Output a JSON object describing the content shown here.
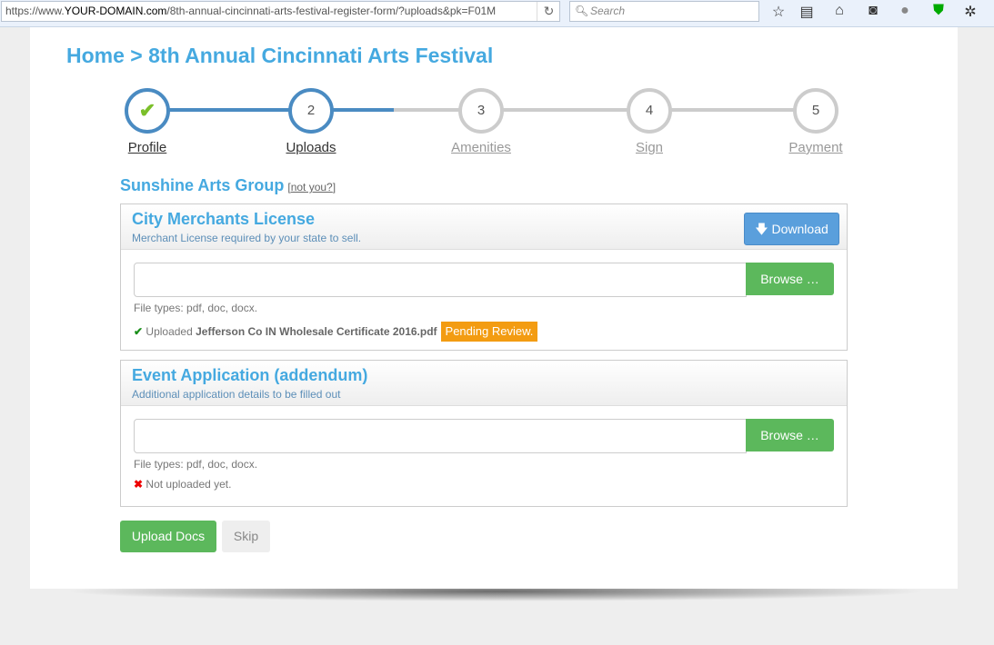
{
  "browser": {
    "url_prefix": "https://www.",
    "url_domain": "YOUR-DOMAIN.com",
    "url_rest": "/8th-annual-cincinnati-arts-festival-register-form/?uploads&pk=F01M",
    "search_placeholder": "Search"
  },
  "breadcrumb": "Home > 8th Annual Cincinnati Arts Festival",
  "steps": [
    {
      "label": "Profile",
      "num": "✔",
      "state": "done"
    },
    {
      "label": "Uploads",
      "num": "2",
      "state": "current"
    },
    {
      "label": "Amenities",
      "num": "3"
    },
    {
      "label": "Sign",
      "num": "4"
    },
    {
      "label": "Payment",
      "num": "5"
    }
  ],
  "group": {
    "name": "Sunshine Arts Group",
    "not_you": "not you?"
  },
  "cards": [
    {
      "title": "City Merchants License",
      "subtitle": "Merchant License required by your state to sell.",
      "download": "Download",
      "browse": "Browse …",
      "filetypes": "File types: pdf, doc, docx.",
      "status_prefix": "Uploaded",
      "filename": "Jefferson Co IN Wholesale Certificate 2016.pdf",
      "badge": "Pending Review."
    },
    {
      "title": "Event Application (addendum)",
      "subtitle": "Additional application details to be filled out",
      "browse": "Browse …",
      "filetypes": "File types: pdf, doc, docx.",
      "status": "Not uploaded yet."
    }
  ],
  "actions": {
    "upload": "Upload Docs",
    "skip": "Skip"
  },
  "colors": {
    "accent": "#45a9e0",
    "success": "#5cb85c",
    "warning": "#f39c12"
  }
}
